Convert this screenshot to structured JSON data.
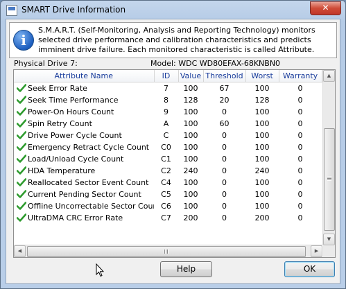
{
  "window": {
    "title": "SMART Drive Information",
    "close_glyph": "✕"
  },
  "info": {
    "icon": "information-icon",
    "icon_glyph": "i",
    "text": "S.M.A.R.T. (Self-Monitoring, Analysis and Reporting Technology) monitors selected drive performance and calibration characteristics and predicts imminent drive failure. Each monitored characteristic is called Attribute."
  },
  "drive": {
    "physical": "Physical Drive 7:",
    "model": "Model: WDC WD80EFAX-68KNBN0"
  },
  "table": {
    "columns": [
      "Attribute Name",
      "ID",
      "Value",
      "Threshold",
      "Worst",
      "Warranty"
    ],
    "rows": [
      {
        "name": "Seek Error Rate",
        "id": "7",
        "value": "100",
        "threshold": "67",
        "worst": "100",
        "warranty": "0"
      },
      {
        "name": "Seek Time Performance",
        "id": "8",
        "value": "128",
        "threshold": "20",
        "worst": "128",
        "warranty": "0"
      },
      {
        "name": "Power-On Hours Count",
        "id": "9",
        "value": "100",
        "threshold": "0",
        "worst": "100",
        "warranty": "0"
      },
      {
        "name": "Spin Retry Count",
        "id": "A",
        "value": "100",
        "threshold": "60",
        "worst": "100",
        "warranty": "0"
      },
      {
        "name": "Drive Power Cycle Count",
        "id": "C",
        "value": "100",
        "threshold": "0",
        "worst": "100",
        "warranty": "0"
      },
      {
        "name": "Emergency Retract Cycle Count",
        "id": "C0",
        "value": "100",
        "threshold": "0",
        "worst": "100",
        "warranty": "0"
      },
      {
        "name": "Load/Unload Cycle Count",
        "id": "C1",
        "value": "100",
        "threshold": "0",
        "worst": "100",
        "warranty": "0"
      },
      {
        "name": "HDA Temperature",
        "id": "C2",
        "value": "240",
        "threshold": "0",
        "worst": "240",
        "warranty": "0"
      },
      {
        "name": "Reallocated Sector Event Count",
        "id": "C4",
        "value": "100",
        "threshold": "0",
        "worst": "100",
        "warranty": "0"
      },
      {
        "name": "Current Pending Sector Count",
        "id": "C5",
        "value": "100",
        "threshold": "0",
        "worst": "100",
        "warranty": "0"
      },
      {
        "name": "Offline Uncorrectable Sector Count",
        "id": "C6",
        "value": "100",
        "threshold": "0",
        "worst": "100",
        "warranty": "0"
      },
      {
        "name": "UltraDMA CRC Error Rate",
        "id": "C7",
        "value": "200",
        "threshold": "0",
        "worst": "200",
        "warranty": "0"
      }
    ],
    "row_icon": "green-check-icon"
  },
  "scrollbars": {
    "up_glyph": "▲",
    "down_glyph": "▼",
    "left_glyph": "◀",
    "right_glyph": "▶"
  },
  "buttons": {
    "help": "Help",
    "ok": "OK"
  },
  "colors": {
    "header_text": "#1a3d9c",
    "check": "#2e9b2e",
    "close": "#c8402f"
  }
}
